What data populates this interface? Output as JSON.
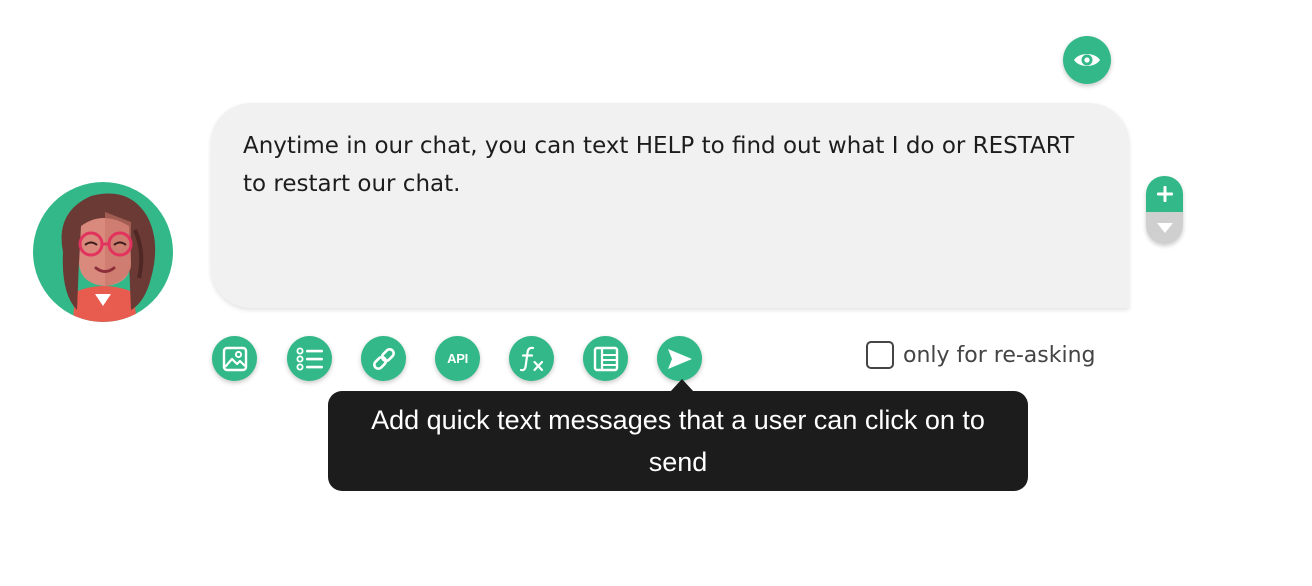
{
  "colors": {
    "accent": "#33b989",
    "bubble_bg": "#f1f1f1",
    "tooltip_bg": "#1c1c1c",
    "secondary_control": "#cfcfcf"
  },
  "header": {
    "preview_icon": "eye-icon"
  },
  "message": {
    "text": "Anytime in our chat, you can text HELP to find out what I do or RESTART to restart our chat."
  },
  "side_controls": {
    "add_icon": "plus-icon",
    "move_icon": "caret-down-icon"
  },
  "toolbar": {
    "items": [
      {
        "icon": "image-icon"
      },
      {
        "icon": "list-icon"
      },
      {
        "icon": "link-icon"
      },
      {
        "icon": "api-icon",
        "label": "API"
      },
      {
        "icon": "function-icon"
      },
      {
        "icon": "table-icon"
      },
      {
        "icon": "send-icon"
      }
    ]
  },
  "reask": {
    "label": "only for re-asking",
    "checked": false
  },
  "tooltip": {
    "text": "Add quick text messages that a user can click on to send"
  }
}
